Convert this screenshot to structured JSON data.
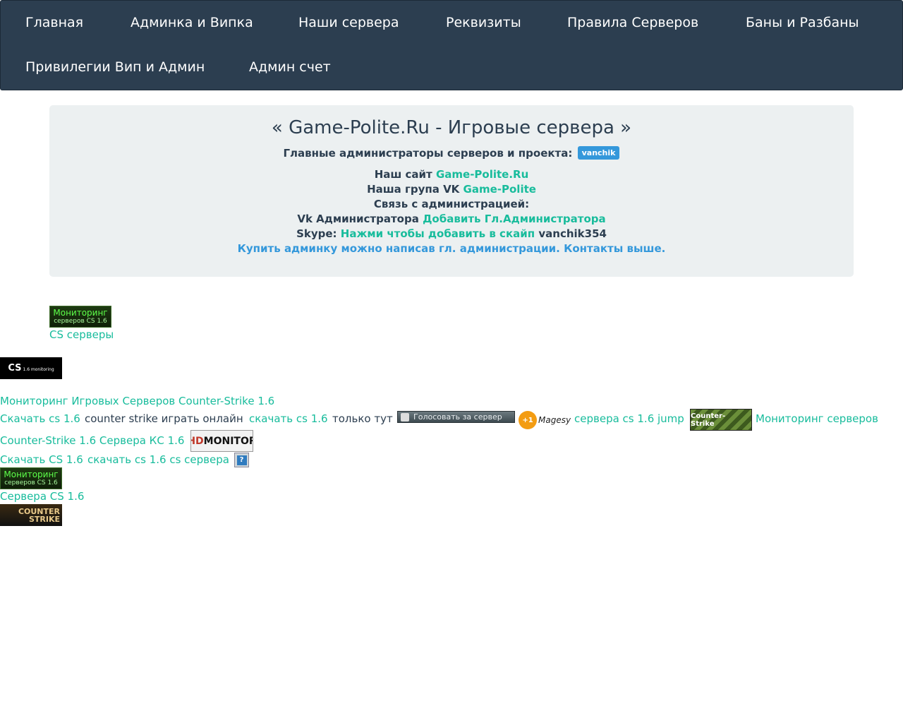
{
  "nav": {
    "items": [
      "Главная",
      "Админка и Випка",
      "Наши сервера",
      "Реквизиты",
      "Правила Серверов",
      "Баны и Разбаны",
      "Привилегии Вип и Админ",
      "Админ счет"
    ]
  },
  "header": {
    "title": "« Game-Polite.Ru - Игровые сервера »",
    "admins_label": "Главные администраторы серверов и проекта:",
    "admin_badge": "vanchik",
    "site_label": "Наш сайт",
    "site_link": "Game-Polite.Ru",
    "vk_group_label": "Наша група VK",
    "vk_group_link": "Game-Polite",
    "contact_label": "Связь с администрацией:",
    "vk_admin_label": "Vk Администратора",
    "vk_admin_link": "Добавить Гл.Администратора",
    "skype_label": "Skype:",
    "skype_link": "Нажми чтобы добавить в скайп",
    "skype_id": "vanchik354",
    "buy_notice": "Купить админку можно написав гл. администрации. Контакты выше."
  },
  "banners": {
    "monitor_green_line1": "Мониторинг",
    "monitor_green_line2": "серверов CS 1.6",
    "cs_servers_link": "CS серверы",
    "cs_monitoring_main": "CS",
    "cs_monitoring_sub": "1.6 monitoring",
    "vote_label": "Голосовать за сервер",
    "magesy_badge": "+1",
    "magesy_label": "Magesy",
    "counter_strike_label": "Counter-Strike",
    "hdmonitor_hd": "HD",
    "hdmonitor_rest": "MONITOR",
    "question_icon": "?",
    "cs_logo_line1": "COUNTER",
    "cs_logo_line2": "STRIKE"
  },
  "links": {
    "monitoring_games": "Мониторинг Игровых Серверов Counter-Strike 1.6",
    "download_cs": "Скачать cs 1.6",
    "play_online": "counter strike играть онлайн",
    "download_cs_lower": "скачать cs 1.6",
    "only_here": "только тут",
    "servers_jump": "сервера cs 1.6 jump",
    "monitoring_servers": "Мониторинг серверов",
    "cs16_servers_kc": "Counter-Strike 1.6 Сервера КС 1.6",
    "download_cs_cap": "Скачать CS 1.6",
    "download_cs_servers": "скачать cs 1.6 cs сервера",
    "servers_cs16": "Сервера CS 1.6"
  }
}
